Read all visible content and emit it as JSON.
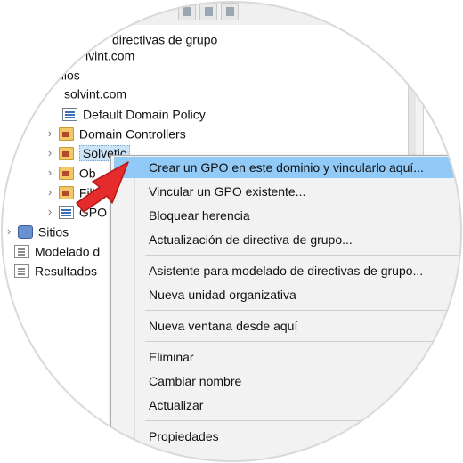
{
  "tree": {
    "items": [
      {
        "label": "directivas de grupo"
      },
      {
        "label": "lvint.com"
      },
      {
        "label": "inios"
      },
      {
        "label": "solvint.com"
      },
      {
        "label": "Default Domain Policy"
      },
      {
        "label": "Domain Controllers"
      },
      {
        "label": "Solvetic"
      },
      {
        "label": "Ob"
      },
      {
        "label": "Filt"
      },
      {
        "label": "GPO"
      },
      {
        "label": "Sitios"
      },
      {
        "label": "Modelado d"
      },
      {
        "label": "Resultados"
      }
    ]
  },
  "context_menu": {
    "items": [
      {
        "label": "Crear un GPO en este dominio y vincularlo aquí..."
      },
      {
        "label": "Vincular un GPO existente..."
      },
      {
        "label": "Bloquear herencia"
      },
      {
        "label": "Actualización de directiva de grupo..."
      },
      {
        "label": "Asistente para modelado de directivas de grupo..."
      },
      {
        "label": "Nueva unidad organizativa"
      },
      {
        "label": "Nueva ventana desde aquí"
      },
      {
        "label": "Eliminar"
      },
      {
        "label": "Cambiar nombre"
      },
      {
        "label": "Actualizar"
      },
      {
        "label": "Propiedades"
      }
    ]
  },
  "colors": {
    "highlight": "#91c9f7",
    "selection": "#cce4f7",
    "arrow": "#e52b2b"
  },
  "icons": [
    "folder-icon",
    "gpo-icon",
    "sites-icon",
    "document-icon",
    "chevron-right-icon",
    "red-arrow-annotation"
  ]
}
